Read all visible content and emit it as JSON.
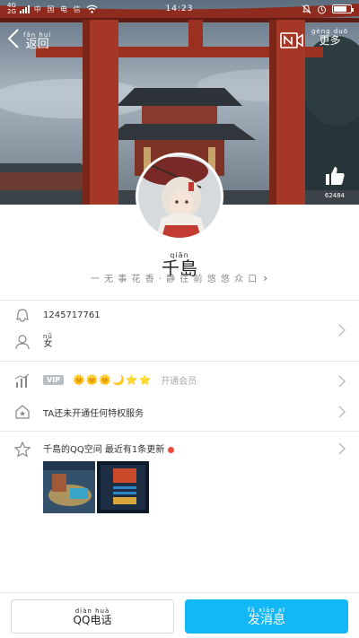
{
  "status_bar": {
    "network_top": "4G",
    "network_bottom": "2G",
    "carrier": "中 国 电 信",
    "time": "14:23",
    "battery_level": 0.8
  },
  "header": {
    "back_label": "返回",
    "back_ruby": "fǎn huí",
    "more_label": "更多",
    "more_ruby": "gèng duō",
    "like_count": "62484"
  },
  "profile": {
    "nickname": "千島",
    "nickname_ruby": "qiān",
    "signature": "一 无 事 花 香 · 静 往 前 悠 悠 众 口"
  },
  "info": {
    "qq_number": "1245717761",
    "gender": "女",
    "gender_ruby": "nǚ",
    "vip_badge": "VIP",
    "level_icons": "🌞🌞🌞🌙⭐⭐",
    "vip_note": "开通会员",
    "privilege_text": "TA还未开通任何特权服务",
    "space_title": "千島的QQ空间 最近有1条更新"
  },
  "actions": {
    "call_label": "QQ电话",
    "call_ruby": "diàn huà",
    "message_label": "发消息",
    "message_ruby": "fā xiāo xī"
  },
  "colors": {
    "accent": "#12b7f5",
    "notify_dot": "#f04a3a",
    "divider": "#e8e8e8"
  }
}
